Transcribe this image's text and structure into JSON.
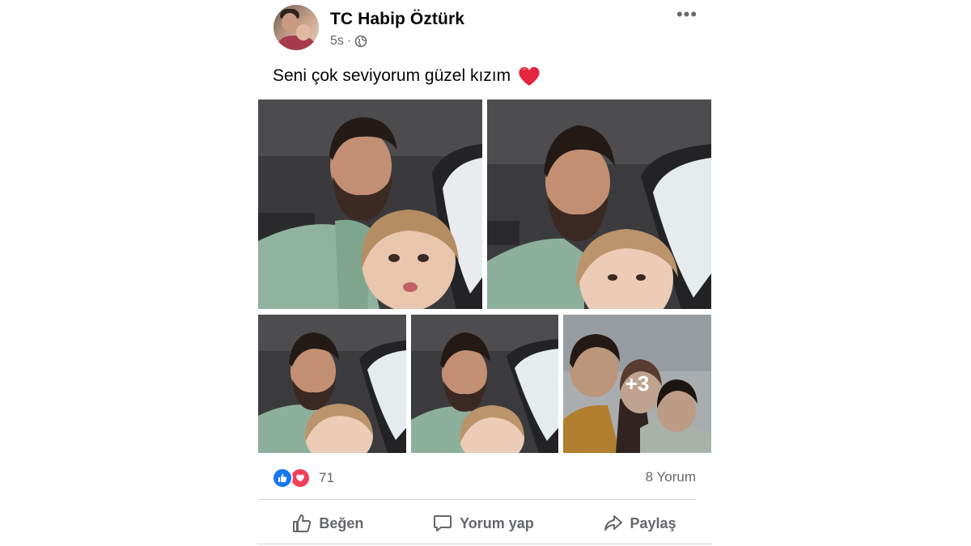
{
  "post": {
    "author": "TC Habip Öztürk",
    "time": "5s",
    "separator": "·",
    "privacy_icon": "globe-icon",
    "more_label": "•••",
    "caption": "Seni çok seviyorum güzel kızım",
    "caption_emoji": "heart-emoji",
    "photos": {
      "extra_count": "+3"
    },
    "reactions": {
      "icons": [
        "like-icon",
        "love-icon"
      ],
      "count": "71"
    },
    "comments_label": "8 Yorum",
    "actions": [
      {
        "label": "Beğen",
        "icon": "thumbs-up-icon"
      },
      {
        "label": "Yorum yap",
        "icon": "comment-icon"
      },
      {
        "label": "Paylaş",
        "icon": "share-icon"
      }
    ]
  },
  "colors": {
    "like_blue": "#1877f2",
    "love_red": "#f33e58",
    "secondary_text": "#65676b"
  }
}
